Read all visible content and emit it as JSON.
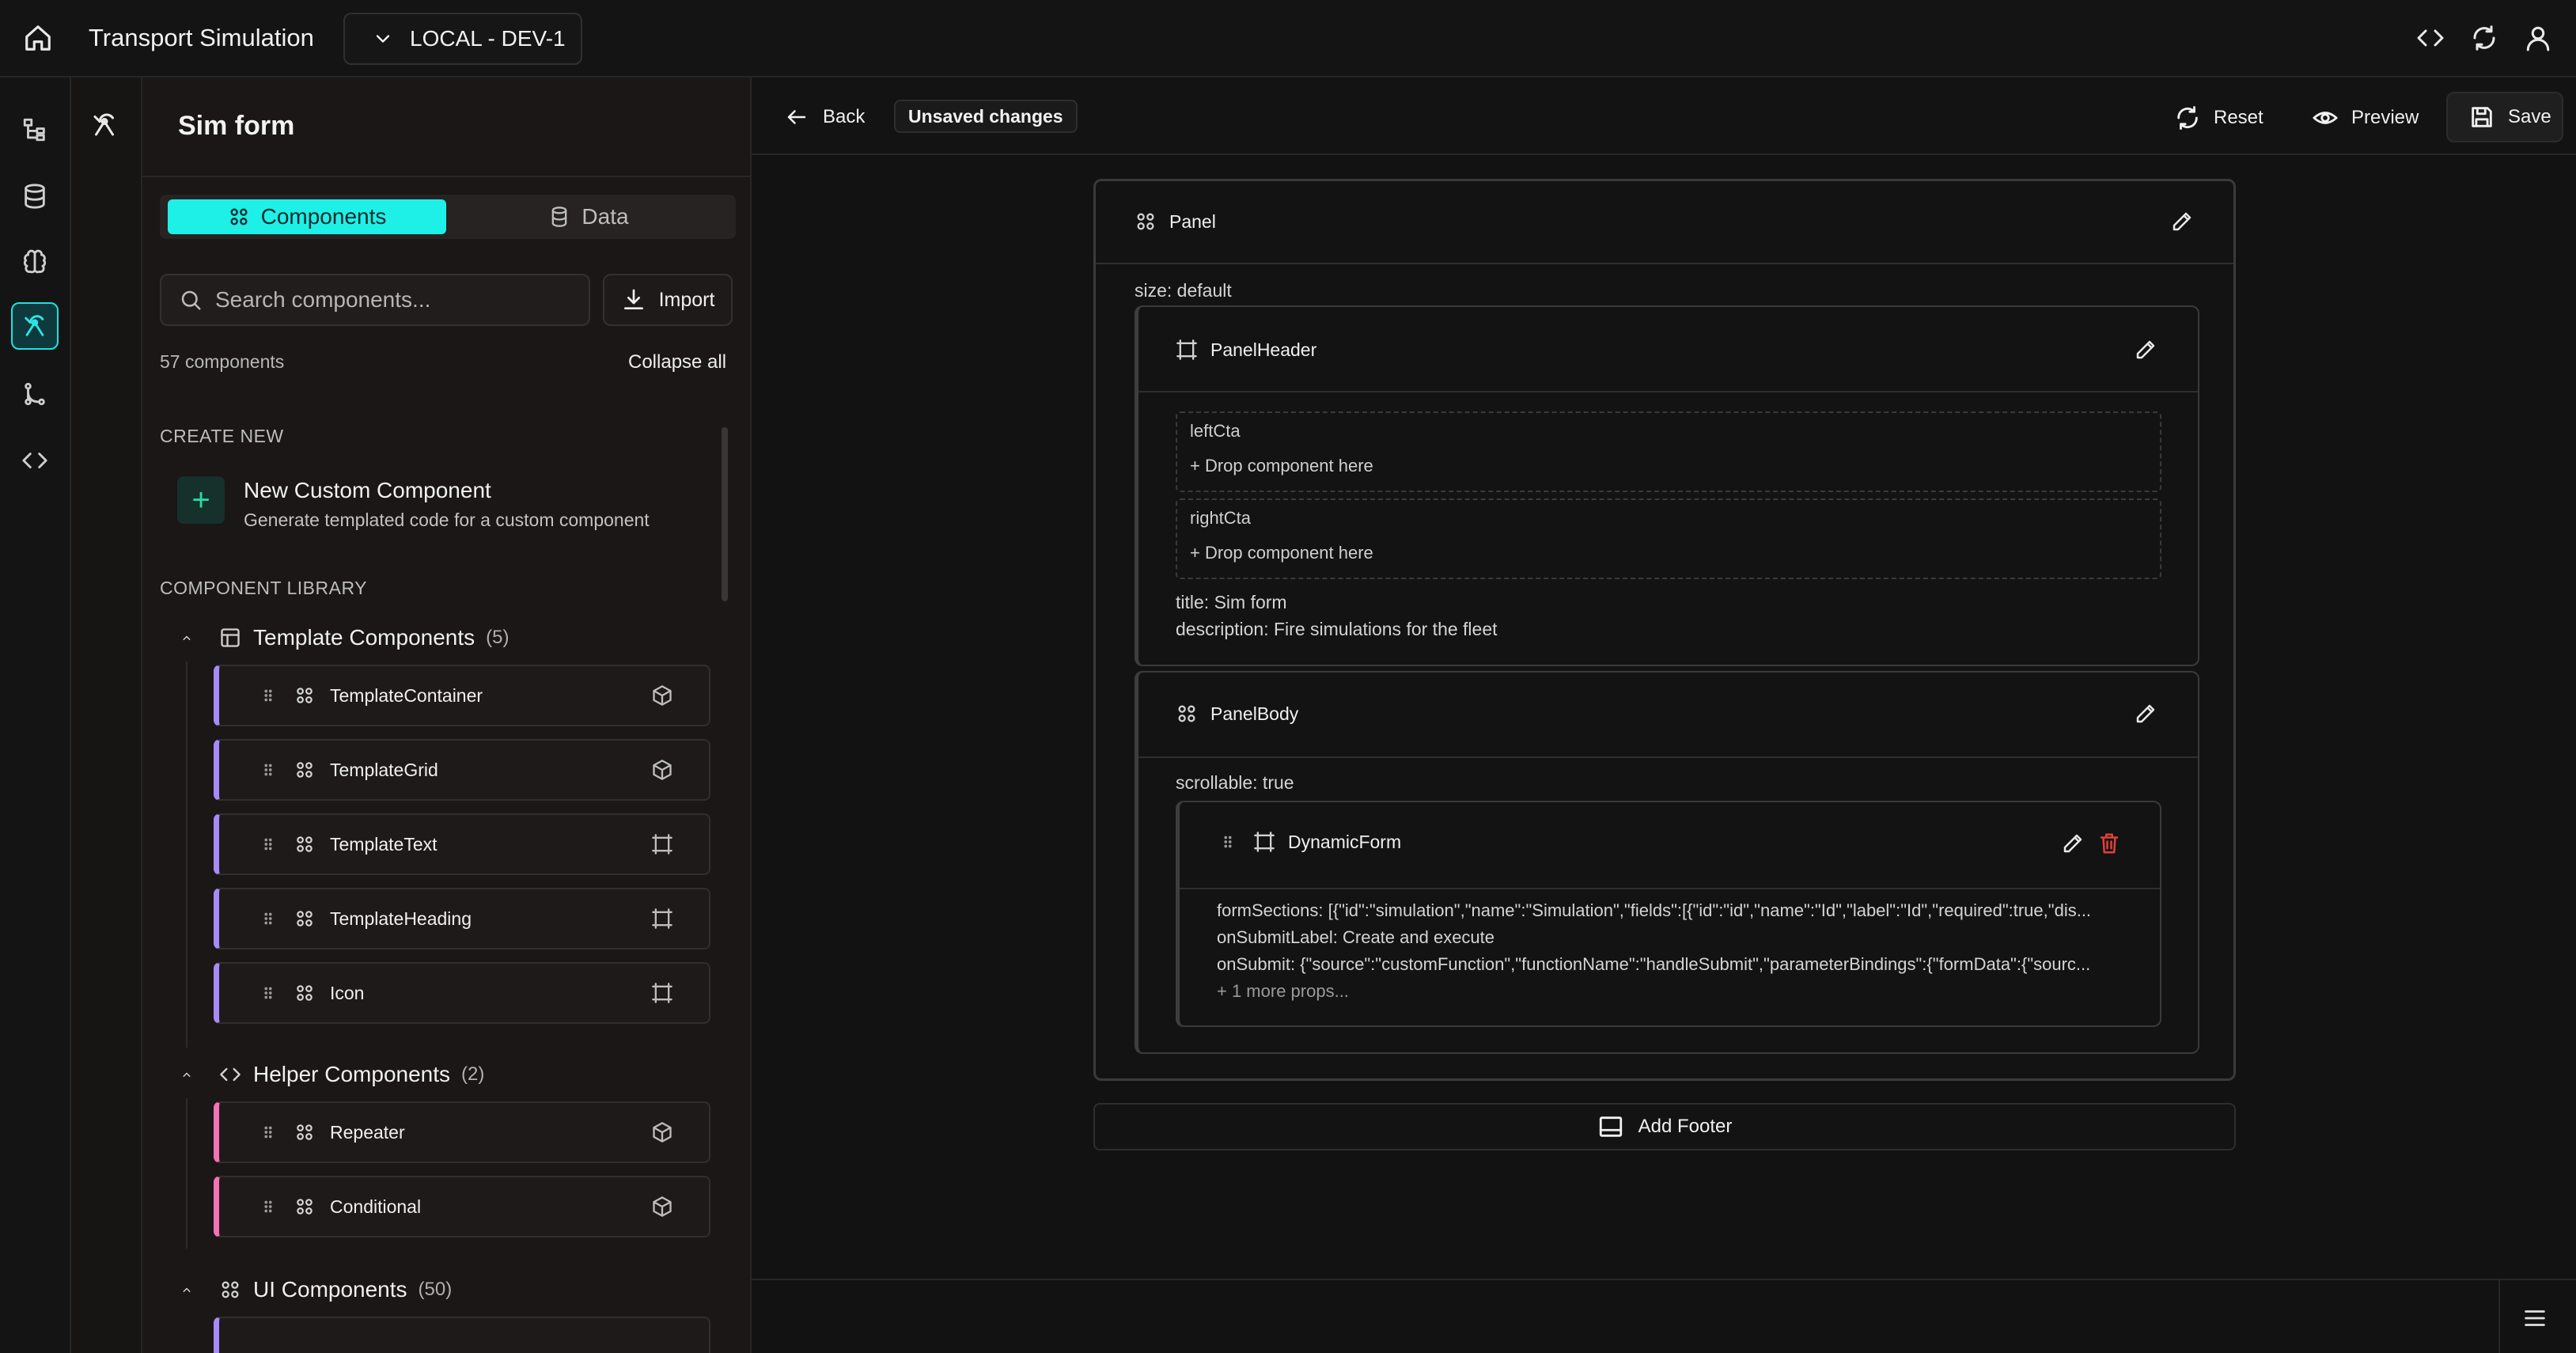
{
  "app": {
    "title": "Transport Simulation",
    "environment": "LOCAL - DEV-1"
  },
  "panel": {
    "title": "Sim form",
    "tabs": [
      {
        "label": "Components"
      },
      {
        "label": "Data"
      }
    ],
    "search_placeholder": "Search components...",
    "import_label": "Import",
    "count_label": "57 components",
    "collapse_label": "Collapse all",
    "create_new_label": "CREATE NEW",
    "new_custom": {
      "title": "New Custom Component",
      "subtitle": "Generate templated code for a custom component"
    },
    "library_label": "COMPONENT LIBRARY",
    "groups": [
      {
        "name": "Template Components",
        "count": "(5)",
        "items": [
          {
            "name": "TemplateContainer",
            "kind": "package-icon"
          },
          {
            "name": "TemplateGrid",
            "kind": "package-icon"
          },
          {
            "name": "TemplateText",
            "kind": "frame-icon"
          },
          {
            "name": "TemplateHeading",
            "kind": "frame-icon"
          },
          {
            "name": "Icon",
            "kind": "frame-icon"
          }
        ]
      },
      {
        "name": "Helper Components",
        "count": "(2)",
        "items": [
          {
            "name": "Repeater",
            "kind": "package-icon"
          },
          {
            "name": "Conditional",
            "kind": "package-icon"
          }
        ]
      },
      {
        "name": "UI Components",
        "count": "(50)",
        "items": []
      }
    ]
  },
  "editor": {
    "back_label": "Back",
    "unsaved_label": "Unsaved changes",
    "reset_label": "Reset",
    "preview_label": "Preview",
    "save_label": "Save",
    "panel": {
      "name": "Panel",
      "size_prop": "size: default"
    },
    "panel_header": {
      "name": "PanelHeader",
      "slots": [
        {
          "name": "leftCta",
          "drop": "+ Drop component here"
        },
        {
          "name": "rightCta",
          "drop": "+ Drop component here"
        }
      ],
      "title_prop": "title: Sim form",
      "description_prop": "description: Fire simulations for the fleet"
    },
    "panel_body": {
      "name": "PanelBody",
      "scrollable_prop": "scrollable: true"
    },
    "dynamic_form": {
      "name": "DynamicForm",
      "props": [
        "formSections: [{\"id\":\"simulation\",\"name\":\"Simulation\",\"fields\":[{\"id\":\"id\",\"name\":\"Id\",\"label\":\"Id\",\"required\":true,\"dis...",
        "onSubmitLabel: Create and execute",
        "onSubmit: {\"source\":\"customFunction\",\"functionName\":\"handleSubmit\",\"parameterBindings\":{\"formData\":{\"sourc..."
      ],
      "more_props": "+ 1 more props..."
    },
    "add_footer_label": "Add Footer"
  },
  "colors": {
    "accent": "#1ef0e8",
    "template_stripe": "#a78bfa",
    "helper_stripe": "#f472b6",
    "delete": "#e0403a"
  }
}
